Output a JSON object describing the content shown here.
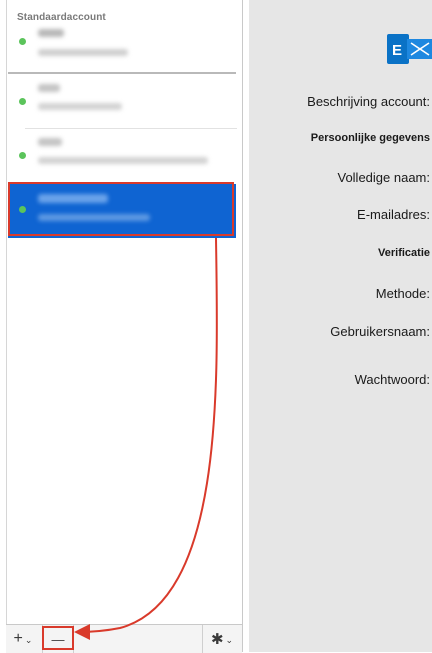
{
  "sidebar": {
    "section_header": "Standaardaccount",
    "accounts": [
      {
        "name": "",
        "email": "",
        "status": "online",
        "selected": false
      },
      {
        "name": "",
        "email": "",
        "status": "online",
        "selected": false
      },
      {
        "name": "",
        "email": "",
        "status": "online",
        "selected": false
      },
      {
        "name": "",
        "email": "",
        "status": "online",
        "selected": true
      }
    ]
  },
  "toolbar": {
    "add_label": "+",
    "add_chevron": "⌄",
    "remove_label": "—",
    "gear_label": "✱",
    "gear_chevron": "⌄"
  },
  "details": {
    "account_description_label": "Beschrijving account:",
    "personal_info_header": "Persoonlijke gegevens",
    "full_name_label": "Volledige naam:",
    "email_label": "E-mailadres:",
    "verification_header": "Verificatie",
    "method_label": "Methode:",
    "username_label": "Gebruikersnaam:",
    "password_label": "Wachtwoord:"
  },
  "colors": {
    "selection": "#0f64d2",
    "annotation": "#d93a2b",
    "status_online": "#5bc45b",
    "exchange_blue": "#0a72c6"
  },
  "icons": {
    "exchange": "exchange-logo-icon",
    "gear": "gear-icon"
  }
}
